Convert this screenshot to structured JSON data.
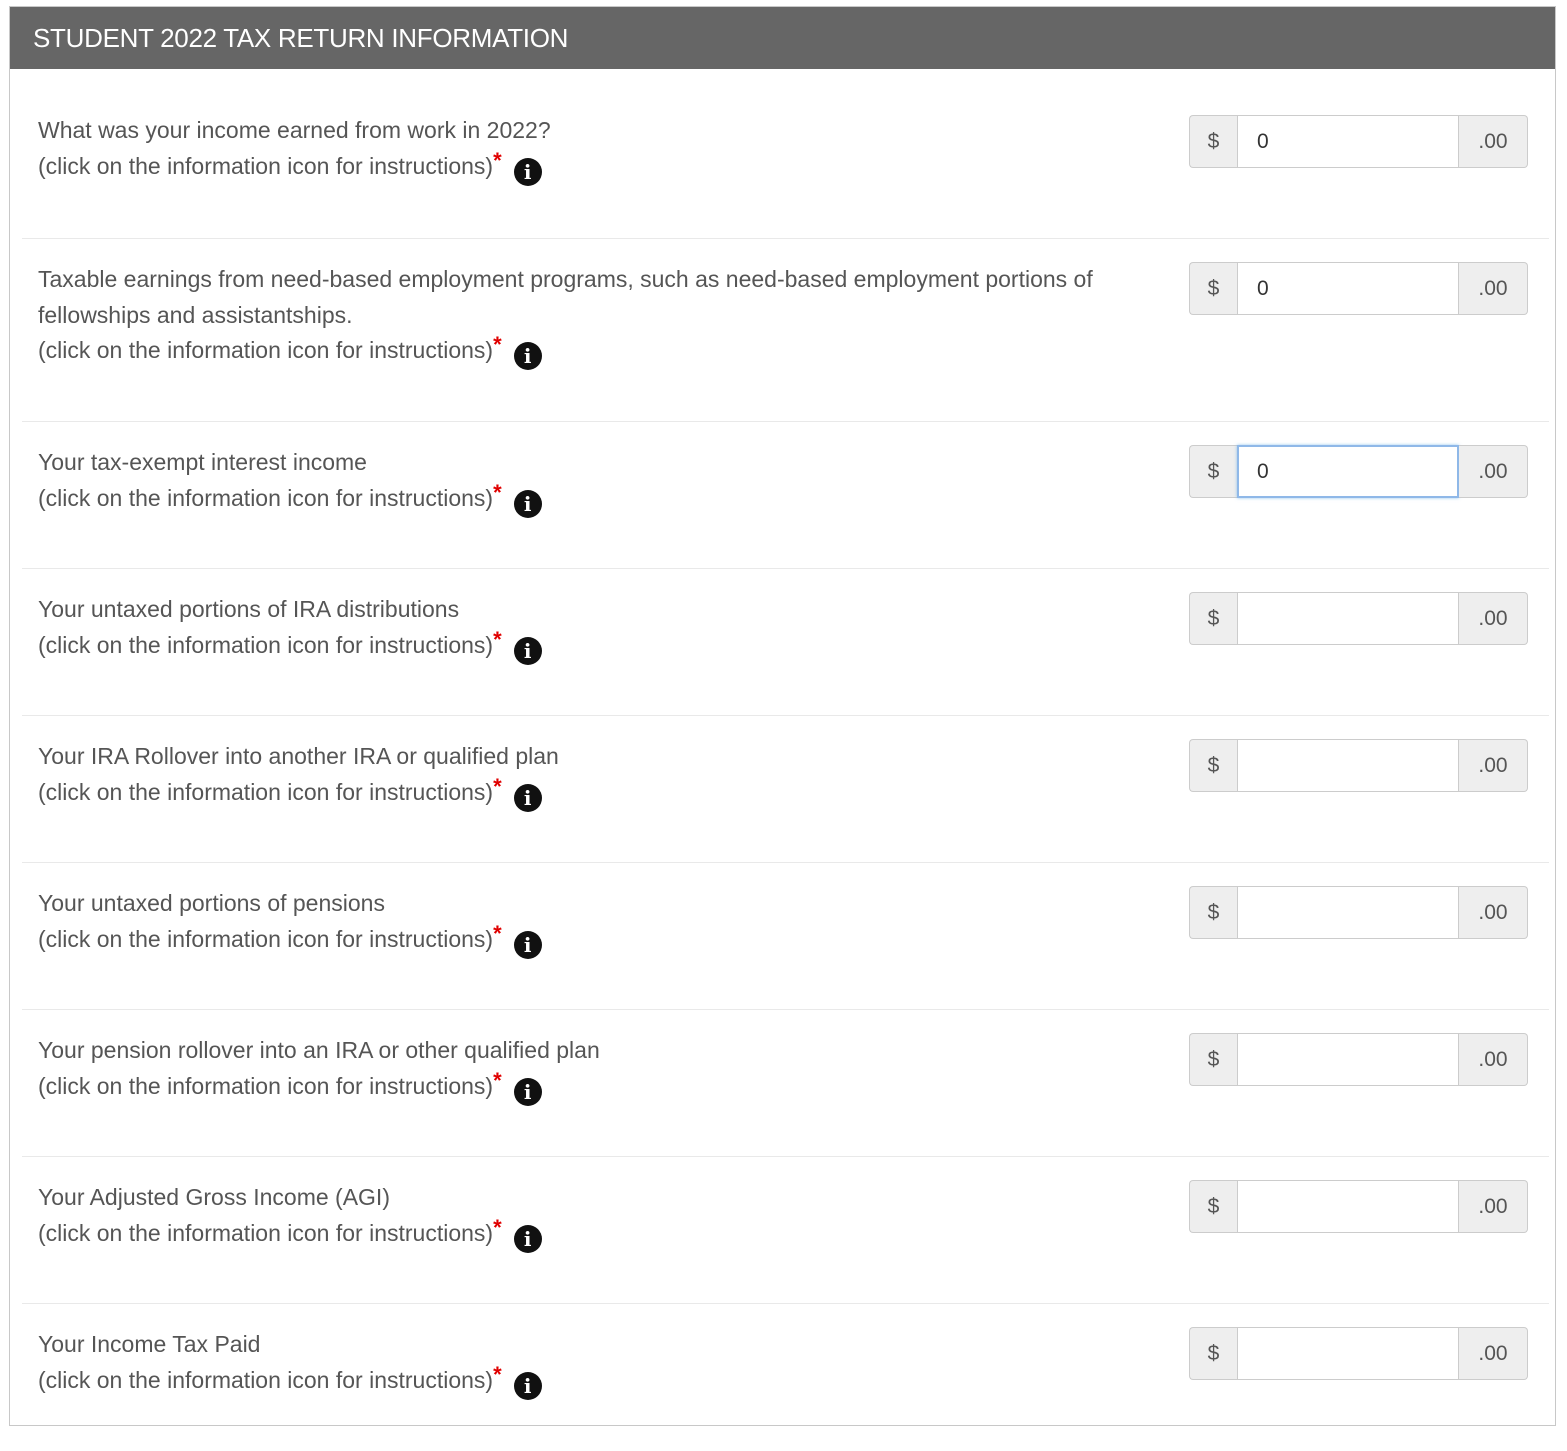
{
  "section": {
    "title": "STUDENT 2022 TAX RETURN INFORMATION"
  },
  "currency_prefix": "$",
  "cents_suffix": ".00",
  "required_marker": "*",
  "info_icon_glyph": "i",
  "fields": [
    {
      "question": "What was your income earned from work in 2022?",
      "hint": "(click on the information icon for instructions)",
      "value": "0",
      "focused": false
    },
    {
      "question": "Taxable earnings from need-based employment programs, such as need-based employment portions of fellowships and assistantships.",
      "hint": "(click on the information icon for instructions)",
      "value": "0",
      "focused": false
    },
    {
      "question": "Your tax-exempt interest income",
      "hint": "(click on the information icon for instructions)",
      "value": "0",
      "focused": true
    },
    {
      "question": "Your untaxed portions of IRA distributions",
      "hint": "(click on the information icon for instructions)",
      "value": "",
      "focused": false
    },
    {
      "question": "Your IRA Rollover into another IRA or qualified plan",
      "hint": "(click on the information icon for instructions)",
      "value": "",
      "focused": false
    },
    {
      "question": "Your untaxed portions of pensions",
      "hint": "(click on the information icon for instructions)",
      "value": "",
      "focused": false
    },
    {
      "question": "Your pension rollover into an IRA or other qualified plan",
      "hint": "(click on the information icon for instructions)",
      "value": "",
      "focused": false
    },
    {
      "question": "Your Adjusted Gross Income (AGI)",
      "hint": "(click on the information icon for instructions)",
      "value": "",
      "focused": false
    },
    {
      "question": "Your Income Tax Paid",
      "hint": "(click on the information icon for instructions)",
      "value": "",
      "focused": false
    }
  ],
  "colors": {
    "header_bg": "#666666",
    "header_text": "#ffffff",
    "label_text": "#555555",
    "required_marker": "#e00000",
    "focus_border": "#8fb8e8"
  }
}
